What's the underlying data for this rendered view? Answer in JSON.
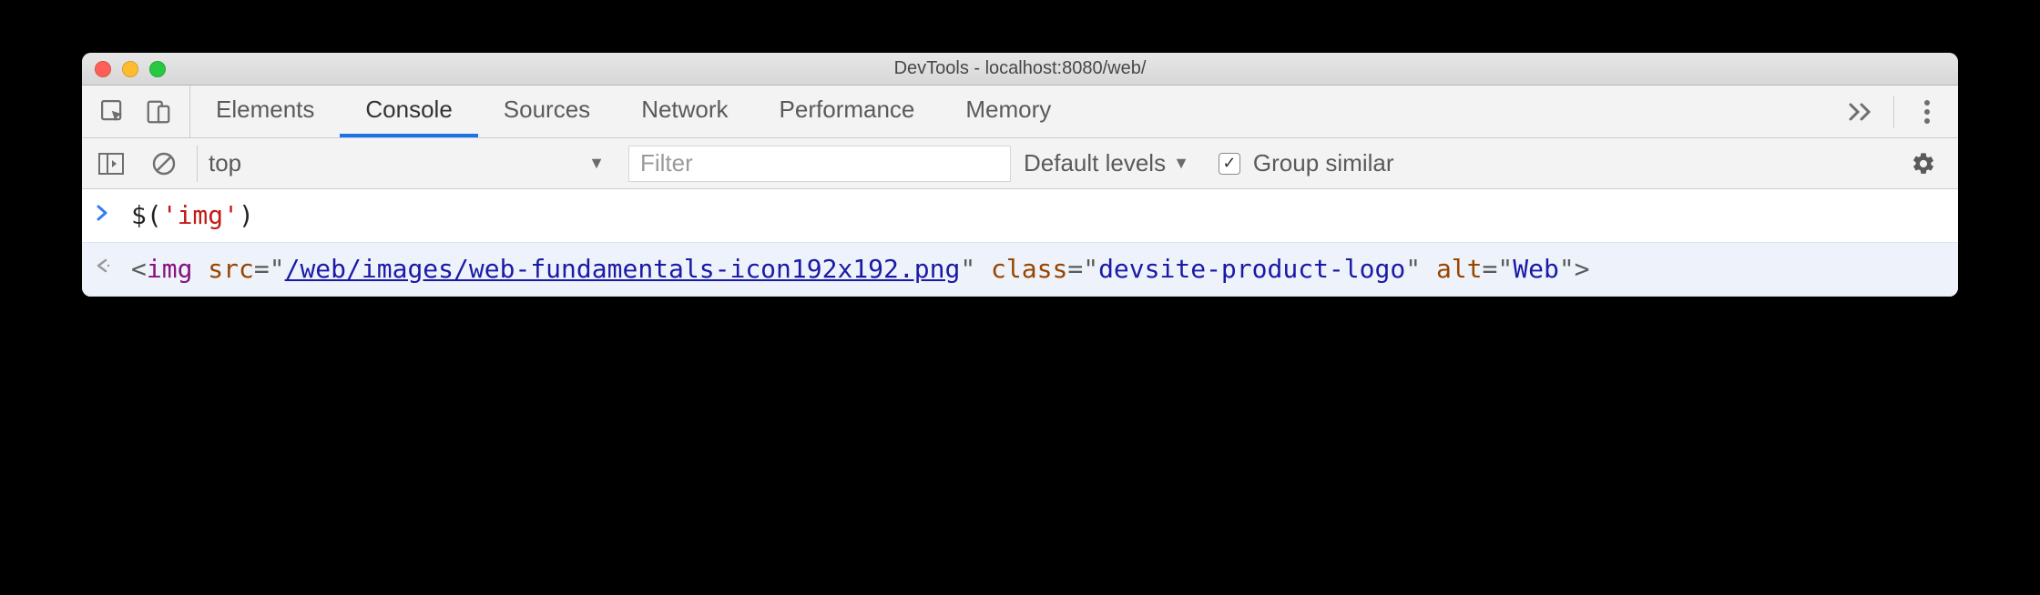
{
  "window": {
    "title": "DevTools - localhost:8080/web/"
  },
  "tabs": {
    "items": [
      "Elements",
      "Console",
      "Sources",
      "Network",
      "Performance",
      "Memory"
    ],
    "active_index": 1
  },
  "toolbar": {
    "context": "top",
    "filter_placeholder": "Filter",
    "levels_label": "Default levels",
    "group_similar_label": "Group similar",
    "group_similar_checked": true
  },
  "console": {
    "input": {
      "fn": "$",
      "arg": "'img'"
    },
    "output": {
      "tag": "img",
      "attrs": {
        "src": "/web/images/web-fundamentals-icon192x192.png",
        "class": "devsite-product-logo",
        "alt": "Web"
      }
    }
  }
}
